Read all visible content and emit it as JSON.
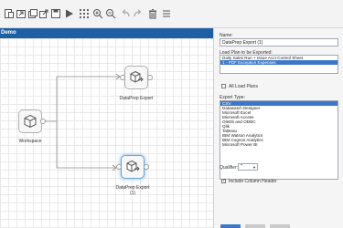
{
  "toolbar": {
    "icons": [
      "new-icon",
      "open-icon",
      "copy-icon",
      "export-icon",
      "save-icon",
      "run-icon",
      "grid-icon",
      "zoom-in-icon",
      "zoom-out-icon",
      "undo-icon",
      "redo-icon",
      "delete-icon",
      "list-icon"
    ]
  },
  "title_bar": {
    "label": "Demo"
  },
  "canvas": {
    "nodes": [
      {
        "label": "Workspace"
      },
      {
        "label": "DataPrep Export"
      },
      {
        "label_line1": "DataPrep Export",
        "label_line2": "(1)"
      }
    ]
  },
  "panel": {
    "name_label": "Name:",
    "name_value": "DataPrep Export (1)",
    "load_plan_label": "Load Plan to be Exported:",
    "load_plans": [
      {
        "text": "Daily Sales Run + Issue Acct Control Sheet",
        "selected": false
      },
      {
        "text": "1 - PDF Exception Expenses",
        "selected": true
      }
    ],
    "all_load_plans_label": "All Load Plans",
    "export_type_label": "Export Type:",
    "export_types": [
      {
        "text": "CSV",
        "selected": true
      },
      {
        "text": "Datawatch Designer",
        "selected": false
      },
      {
        "text": "Microsoft Excel",
        "selected": false
      },
      {
        "text": "Microsoft Access",
        "selected": false
      },
      {
        "text": "OleDb and ODBC",
        "selected": false
      },
      {
        "text": "Qlik",
        "selected": false
      },
      {
        "text": "Tableau",
        "selected": false
      },
      {
        "text": "IBM Watson Analytics",
        "selected": false
      },
      {
        "text": "IBM Cognos Analytics",
        "selected": false
      },
      {
        "text": "Microsoft Power BI",
        "selected": false
      }
    ],
    "qualifier_label": "Qualifier:",
    "qualifier_value": "\"",
    "include_header_label": "Include Column Header",
    "include_header_checked": true
  },
  "colors": {
    "accent": "#1f5fa3",
    "selection": "#3b78c9"
  }
}
